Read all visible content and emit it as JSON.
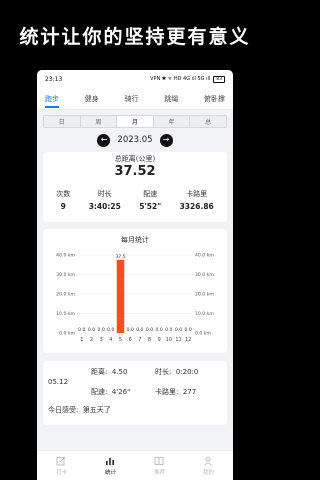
{
  "promo": {
    "headline": "统计让你的坚持更有意义"
  },
  "status_bar": {
    "time": "23:13",
    "indicators": "VPN ✱ ᯤ HD 4G ıll 5G ıll",
    "battery": "83"
  },
  "activity_tabs": [
    {
      "label": "跑步",
      "active": true
    },
    {
      "label": "健身",
      "active": false
    },
    {
      "label": "骑行",
      "active": false
    },
    {
      "label": "跳绳",
      "active": false
    },
    {
      "label": "俯卧撑",
      "active": false
    }
  ],
  "range_tabs": [
    {
      "label": "日",
      "active": false
    },
    {
      "label": "周",
      "active": false
    },
    {
      "label": "月",
      "active": true
    },
    {
      "label": "年",
      "active": false
    },
    {
      "label": "总",
      "active": false
    }
  ],
  "period": {
    "label": "2023.05",
    "prev_icon": "arrow-left-icon",
    "next_icon": "arrow-right-icon"
  },
  "summary": {
    "total_label": "总距离(公里)",
    "total_value": "37.52",
    "stats": [
      {
        "label": "次数",
        "value": "9"
      },
      {
        "label": "时长",
        "value": "3:40:25"
      },
      {
        "label": "配速",
        "value": "5'52\""
      },
      {
        "label": "卡路里",
        "value": "3326.86"
      }
    ]
  },
  "chart_title": "每月统计",
  "chart_data": {
    "type": "bar",
    "title": "每月统计",
    "categories": [
      "1",
      "2",
      "3",
      "4",
      "5",
      "6",
      "7",
      "8",
      "9",
      "10",
      "11",
      "12"
    ],
    "values": [
      0,
      0,
      0,
      0,
      37.5,
      0,
      0,
      0,
      0,
      0,
      0,
      0
    ],
    "data_labels": [
      "0.0",
      "0.0",
      "0.0",
      "0.0",
      "37.5",
      "0.0",
      "0.0",
      "0.0",
      "0.0",
      "0.0",
      "0.0",
      "0.0"
    ],
    "y_ticks": [
      "0.0 km",
      "10.0 km",
      "20.0 km",
      "30.0 km",
      "40.0 km"
    ],
    "ylim": [
      0,
      40
    ],
    "grid": true,
    "bar_color": "#f4511e",
    "highlight_bar_color": "#e54b1e"
  },
  "detail": {
    "date": "05.12",
    "distance_label": "距离:",
    "distance_value": "4.50",
    "duration_label": "时长:",
    "duration_value": "0:20:0",
    "pace_label": "配速:",
    "pace_value": "4'26\"",
    "calorie_label": "卡路里:",
    "calorie_value": "277",
    "feeling_label": "今日感受:",
    "feeling_value": "第五天了"
  },
  "bottom_nav": [
    {
      "label": "打卡",
      "icon": "edit-icon",
      "active": false
    },
    {
      "label": "统计",
      "icon": "bar-chart-icon",
      "active": true
    },
    {
      "label": "推荐",
      "icon": "book-icon",
      "active": false
    },
    {
      "label": "我的",
      "icon": "user-icon",
      "active": false
    }
  ],
  "colors": {
    "accent": "#1677ff",
    "bar": "#f4511e"
  }
}
